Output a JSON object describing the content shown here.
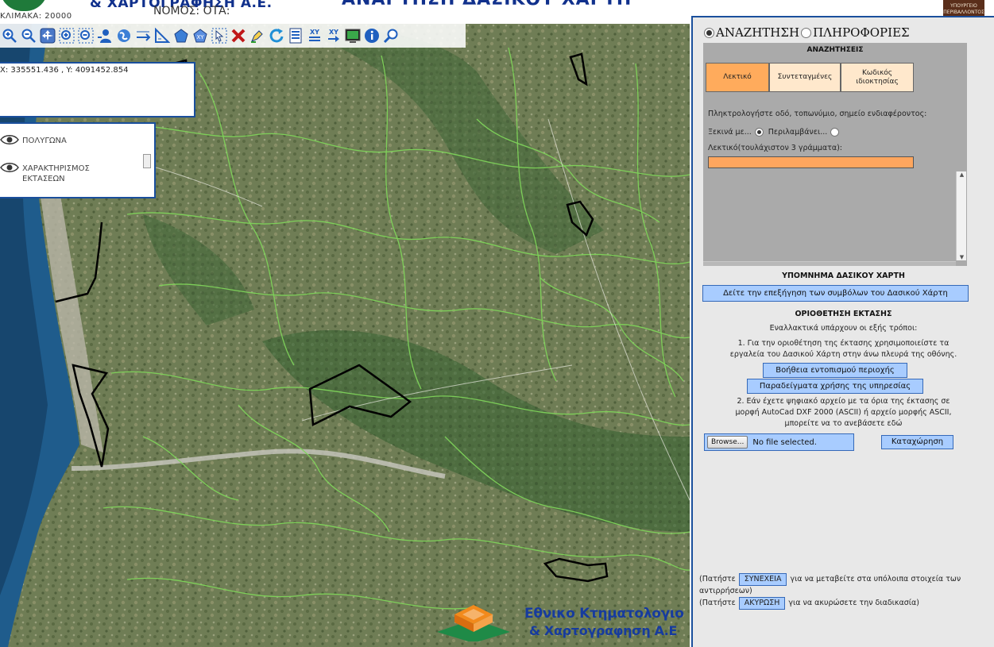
{
  "header": {
    "logo_text": "& ΧΑΡΤΟΓΡΑΦΗΣΗ Α.Ε.",
    "scale_text": "ΚΛΙΜΑΚΑ: 20000",
    "nomos_text": "ΝΟΜΟΣ:   ΟΤΑ:",
    "title": "ΑΝΑΡΤΗΣΗ ΔΑΣΙΚΟΥ ΧΑΡΤΗ",
    "ministry_logo_text": "ΥΠΟΥΡΓΕΙΟ ΠΕΡΙΒΑΛΛΟΝΤΟΣ"
  },
  "map": {
    "toolbar_icons": [
      "zoom-in-icon",
      "zoom-out-icon",
      "pan-icon",
      "zoom-box-in-icon",
      "zoom-box-out-icon",
      "identify-person-icon",
      "full-extent-icon",
      "measure-distance-icon",
      "measure-angle-icon",
      "measure-area-icon",
      "go-to-xy-icon",
      "select-icon",
      "clear-icon",
      "draw-edit-icon",
      "refresh-icon",
      "legend-icon",
      "xy-list-icon",
      "xy-export-icon",
      "print-screen-icon",
      "info-icon",
      "search-locate-icon"
    ],
    "coords": "X: 335551.436 , Y: 4091452.854",
    "layers": [
      {
        "label": "ΠΟΛΥΓΩΝΑ"
      },
      {
        "label": "ΧΑΡΑΚΤΗΡΙΣΜΟΣ\nΕΚΤΑΣΕΩΝ"
      }
    ],
    "watermark_line1": "Εθνικο Κτηματολογιο",
    "watermark_line2": "& Χαρτογραφηση Α.Ε"
  },
  "panel": {
    "radio_search": "ΑΝΑΖΗΤΗΣΗ",
    "radio_info": "ΠΛΗΡΟΦΟΡΙΕΣ",
    "search_title": "ΑΝΑΖΗΤΗΣΕΙΣ",
    "tabs": [
      "Λεκτικό",
      "Συντεταγμένες",
      "Κωδικός\nιδιοκτησίας"
    ],
    "prompt": "Πληκτρολογήστε οδό, τοπωνύμιο, σημείο ενδιαφέροντος:",
    "starts_with": "Ξεκινά με...",
    "contains": "Περιλαμβάνει...",
    "lektiko_label": "Λεκτικό(τουλάχιστον 3 γράμματα):",
    "search_value": "",
    "legend_title": "ΥΠΟΜΝΗΜΑ ΔΑΣΙΚΟΥ ΧΑΡΤΗ",
    "legend_button": "Δείτε την επεξήγηση των συμβόλων του Δασικού Χάρτη",
    "boundary_title": "ΟΡΙΟΘΕΤΗΣΗ ΕΚΤΑΣΗΣ",
    "boundary_intro": "Εναλλακτικά υπάρχουν οι εξής τρόποι:",
    "boundary_step1": "1. Για την οριοθέτηση της έκτασης χρησιμοποιείστε τα\nεργαλεία του Δασικού Χάρτη στην άνω πλευρά της οθόνης.",
    "help_button": "Βοήθεια εντοπισμού περιοχής",
    "examples_button": "Παραδείγματα χρήσης της υπηρεσίας",
    "boundary_step2": "2. Εάν έχετε ψηφιακό αρχείο με τα όρια της έκτασης σε\nμορφή AutoCad DXF 2000 (ASCII) ή αρχείο μορφής ASCII,\nμπορείτε να το ανεβάσετε εδώ",
    "browse_button": "Browse...",
    "file_text": "No file selected.",
    "register_button": "Καταχώρηση",
    "continue_prefix": "(Πατήστε",
    "continue_button": "ΣΥΝΕΧΕΙΑ",
    "continue_suffix": "για να μεταβείτε στα υπόλοιπα στοιχεία των αντιρρήσεων)",
    "cancel_prefix": "(Πατήστε",
    "cancel_button": "ΑΚΥΡΩΣΗ",
    "cancel_suffix": "για να ακυρώσετε την διαδικασία)"
  },
  "colors": {
    "brand_blue": "#10308c",
    "panel_border": "#1a4f9c",
    "active_tab": "#ffab5c",
    "button_blue": "#a8ccff",
    "forest_green": "#7fd45a"
  }
}
